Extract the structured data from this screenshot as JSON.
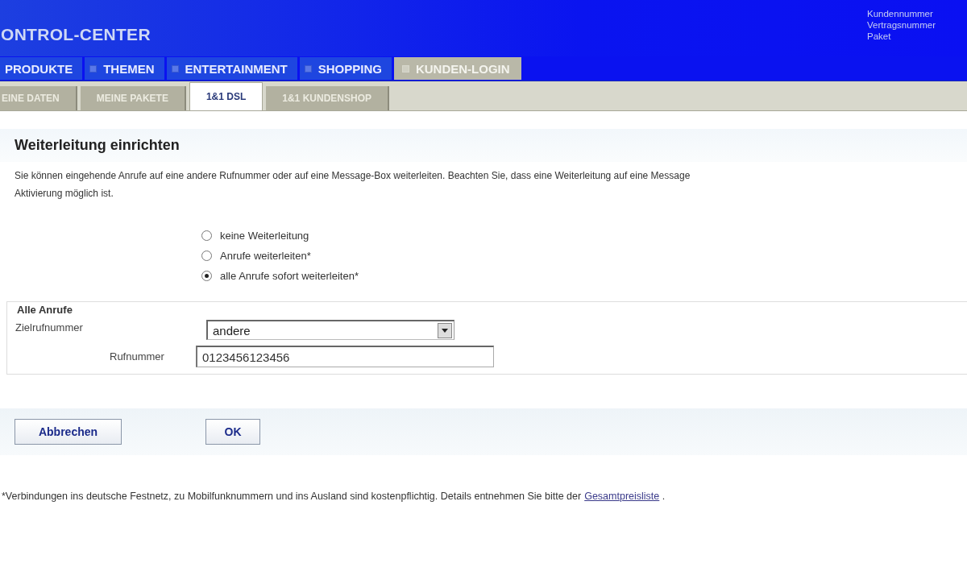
{
  "header": {
    "title": "ONTROL-CENTER",
    "account_labels": [
      "Kundennummer",
      "Vertragsnummer",
      "Paket"
    ]
  },
  "main_tabs": [
    {
      "label": "PRODUKTE",
      "selected": false,
      "icon": false
    },
    {
      "label": "THEMEN",
      "selected": false,
      "icon": true
    },
    {
      "label": "ENTERTAINMENT",
      "selected": false,
      "icon": true
    },
    {
      "label": "SHOPPING",
      "selected": false,
      "icon": true
    },
    {
      "label": "KUNDEN-LOGIN",
      "selected": true,
      "icon": true
    }
  ],
  "sub_tabs": [
    {
      "label": "EINE DATEN",
      "selected": false
    },
    {
      "label": "MEINE PAKETE",
      "selected": false
    },
    {
      "label": "1&1 DSL",
      "selected": true
    },
    {
      "label": "1&1 KUNDENSHOP",
      "selected": false
    }
  ],
  "form": {
    "heading": "Weiterleitung einrichten",
    "description": [
      "Sie können eingehende Anrufe auf eine andere Rufnummer oder auf eine Message-Box weiterleiten. Beachten Sie, dass eine Weiterleitung auf eine Message",
      "Aktivierung möglich ist."
    ],
    "options": [
      {
        "label": "keine Weiterleitung",
        "selected": false
      },
      {
        "label": "Anrufe weiterleiten*",
        "selected": false
      },
      {
        "label": "alle Anrufe sofort weiterleiten*",
        "selected": true
      }
    ],
    "group": {
      "legend": "Alle Anrufe",
      "target_label": "Zielrufnummer",
      "target_value": "andere",
      "number_label": "Rufnummer",
      "number_value": "0123456123456"
    },
    "buttons": [
      "Abbrechen",
      "OK"
    ]
  },
  "footnote": {
    "text": "*Verbindungen ins deutsche Festnetz, zu Mobilfunknummern und ins Ausland sind kostenpflichtig. Details entnehmen Sie bitte der",
    "link": "Gesamtpreisliste",
    "suffix": "."
  }
}
